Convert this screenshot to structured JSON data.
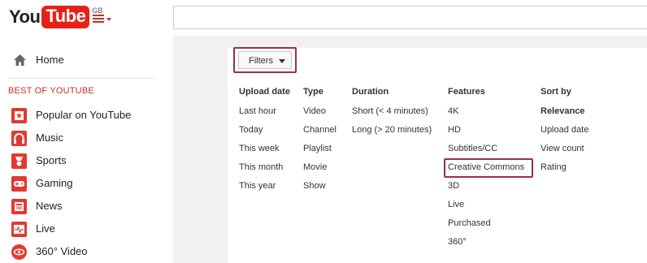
{
  "header": {
    "logo_you": "You",
    "logo_tube": "Tube",
    "region": "GB",
    "search_placeholder": ""
  },
  "sidebar": {
    "home": "Home",
    "section_title": "BEST OF YOUTUBE",
    "items": [
      {
        "label": "Popular on YouTube",
        "icon": "star-icon"
      },
      {
        "label": "Music",
        "icon": "headphones-icon"
      },
      {
        "label": "Sports",
        "icon": "trophy-icon"
      },
      {
        "label": "Gaming",
        "icon": "gamepad-icon"
      },
      {
        "label": "News",
        "icon": "newspaper-icon"
      },
      {
        "label": "Live",
        "icon": "pulse-icon"
      },
      {
        "label": "360° Video",
        "icon": "360-icon"
      }
    ]
  },
  "filters": {
    "button_label": "Filters",
    "columns": [
      {
        "heading": "Upload date",
        "options": [
          "Last hour",
          "Today",
          "This week",
          "This month",
          "This year"
        ]
      },
      {
        "heading": "Type",
        "options": [
          "Video",
          "Channel",
          "Playlist",
          "Movie",
          "Show"
        ]
      },
      {
        "heading": "Duration",
        "options": [
          "Short (< 4 minutes)",
          "Long (> 20 minutes)"
        ]
      },
      {
        "heading": "Features",
        "options": [
          "4K",
          "HD",
          "Subtitles/CC",
          "Creative Commons",
          "3D",
          "Live",
          "Purchased",
          "360°"
        ]
      },
      {
        "heading": "Sort by",
        "options": [
          "Relevance",
          "Upload date",
          "View count",
          "Rating"
        ]
      }
    ]
  },
  "colors": {
    "brand_red": "#e62117",
    "highlight": "#9b2b55",
    "section_red": "#c4302b"
  }
}
